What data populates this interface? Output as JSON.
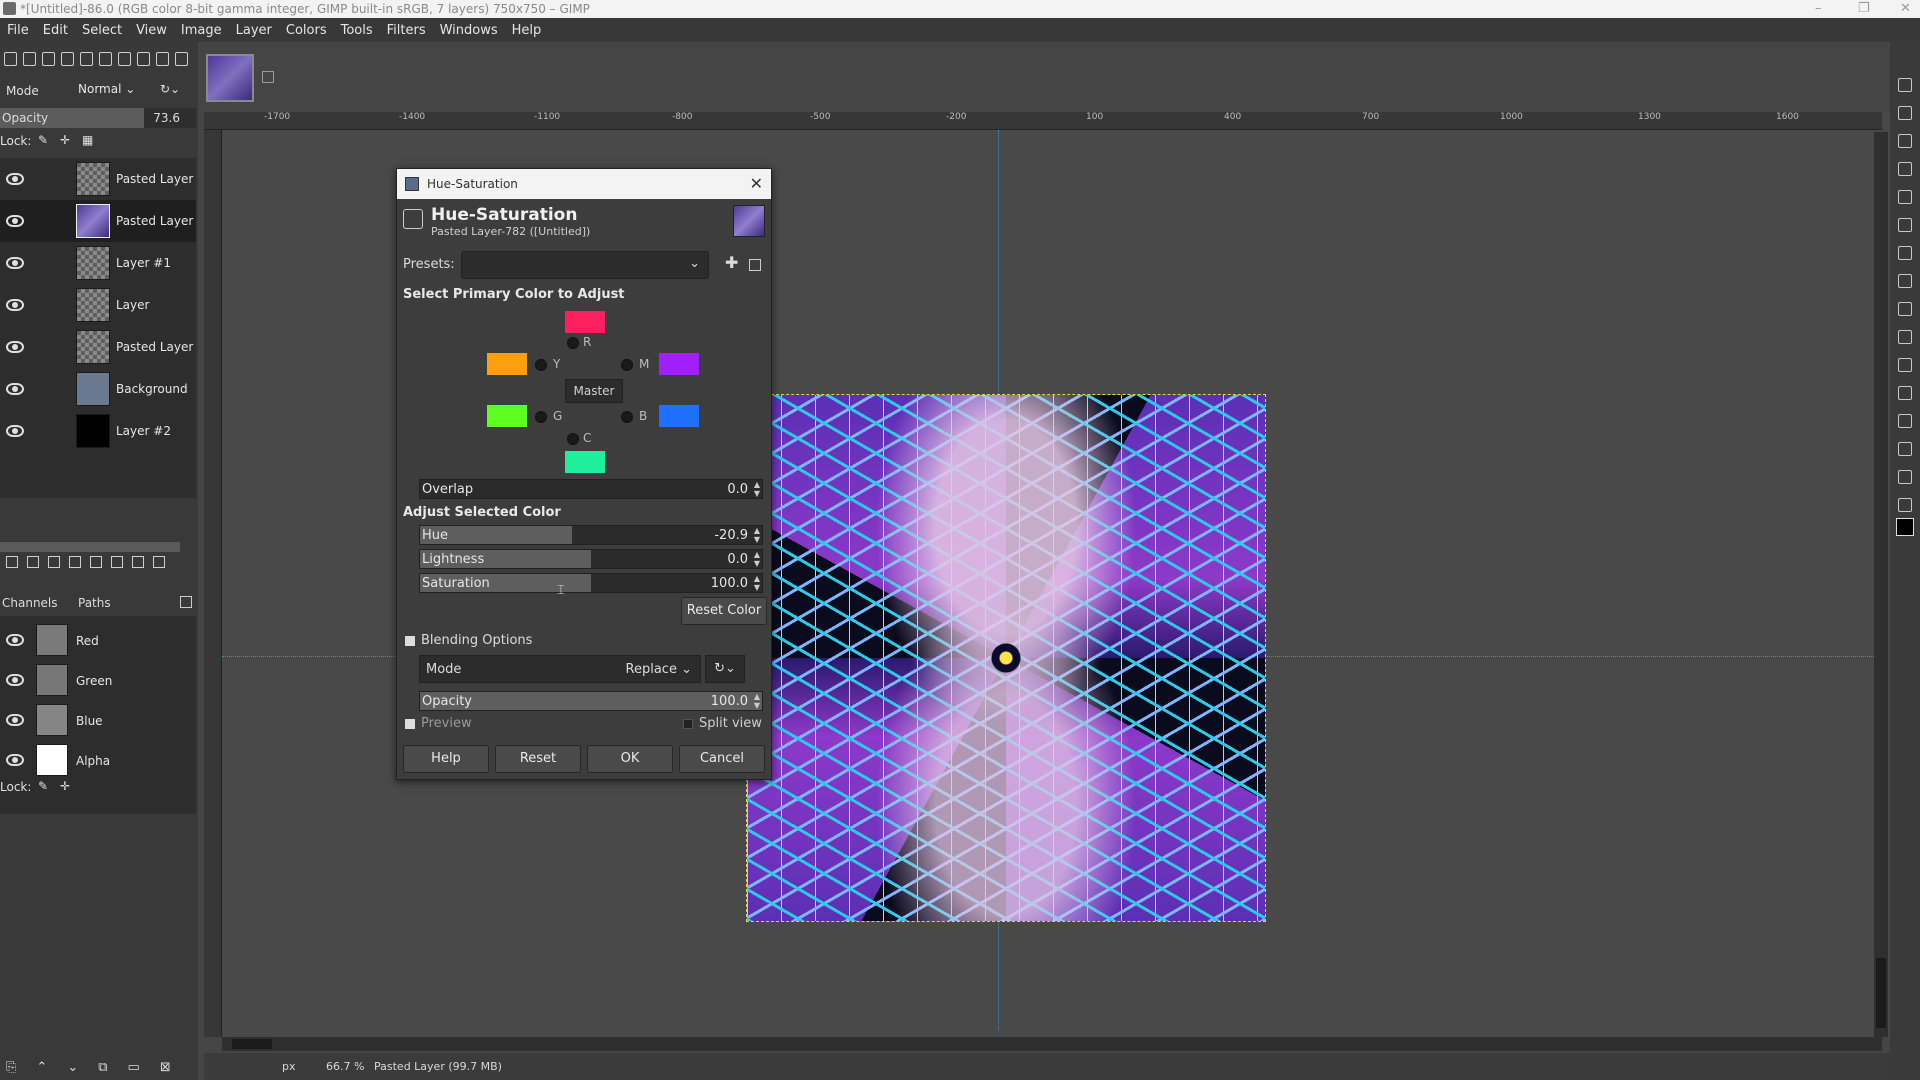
{
  "window": {
    "title": "*[Untitled]-86.0 (RGB color 8-bit gamma integer, GIMP built-in sRGB, 7 layers) 750x750 – GIMP"
  },
  "menu": [
    "File",
    "Edit",
    "Select",
    "View",
    "Image",
    "Layer",
    "Colors",
    "Tools",
    "Filters",
    "Windows",
    "Help"
  ],
  "layers_panel": {
    "mode_label": "Mode",
    "mode_value": "Normal",
    "opacity_label": "Opacity",
    "opacity_value": "73.6",
    "opacity_fraction": 0.736,
    "lock_label": "Lock:",
    "layers": [
      {
        "name": "Pasted Layer",
        "selected": false
      },
      {
        "name": "Pasted Layer",
        "selected": true
      },
      {
        "name": "Layer #1",
        "selected": false
      },
      {
        "name": "Layer",
        "selected": false
      },
      {
        "name": "Pasted Layer",
        "selected": false
      },
      {
        "name": "Background",
        "selected": false
      },
      {
        "name": "Layer #2",
        "selected": false
      }
    ]
  },
  "channels_panel": {
    "tab_channels": "Channels",
    "tab_paths": "Paths",
    "lock_label": "Lock:",
    "channels": [
      "Red",
      "Green",
      "Blue",
      "Alpha"
    ]
  },
  "ruler": {
    "ticks": [
      "-1700",
      "-1400",
      "-1100",
      "-800",
      "-500",
      "-200",
      "100",
      "400",
      "700",
      "1000",
      "1300",
      "1600"
    ]
  },
  "statusbar": {
    "unit": "px",
    "zoom": "66.7 %",
    "info": "Pasted Layer (99.7 MB)"
  },
  "dialog": {
    "title": "Hue-Saturation",
    "heading": "Hue-Saturation",
    "subtitle": "Pasted Layer-782 ([Untitled])",
    "presets_label": "Presets:",
    "select_primary_label": "Select Primary Color to Adjust",
    "master_label": "Master",
    "colors": {
      "R": {
        "label": "R",
        "color": "#ff1f5e"
      },
      "Y": {
        "label": "Y",
        "color": "#ff9f0f"
      },
      "G": {
        "label": "G",
        "color": "#5cff1f"
      },
      "C": {
        "label": "C",
        "color": "#1fef9a"
      },
      "B": {
        "label": "B",
        "color": "#1f6fff"
      },
      "M": {
        "label": "M",
        "color": "#a01fff"
      }
    },
    "overlap": {
      "label": "Overlap",
      "value": "0.0"
    },
    "adjust_selected_label": "Adjust Selected Color",
    "hue": {
      "label": "Hue",
      "value": "-20.9",
      "fraction": 0.445
    },
    "lightness": {
      "label": "Lightness",
      "value": "0.0",
      "fraction": 0.5
    },
    "saturation": {
      "label": "Saturation",
      "value": "100.0",
      "fraction": 0.5
    },
    "reset_color_label": "Reset Color",
    "blending_label": "Blending Options",
    "mode_label": "Mode",
    "mode_value": "Replace",
    "opacity": {
      "label": "Opacity",
      "value": "100.0",
      "fraction": 1.0
    },
    "preview_label": "Preview",
    "split_view_label": "Split view",
    "buttons": {
      "help": "Help",
      "reset": "Reset",
      "ok": "OK",
      "cancel": "Cancel"
    }
  }
}
